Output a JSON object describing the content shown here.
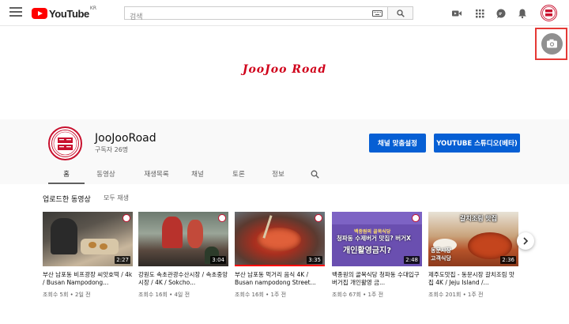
{
  "topbar": {
    "logo_text": "YouTube",
    "logo_region": "KR",
    "search_placeholder": "검색",
    "icons": [
      "menu-icon",
      "keyboard-icon",
      "search-icon",
      "video-camera-icon",
      "apps-grid-icon",
      "chat-icon",
      "bell-icon"
    ]
  },
  "banner": {
    "title": "JooJoo Road",
    "camera_icon": "camera-icon"
  },
  "channel": {
    "name": "JooJooRoad",
    "subscribers": "구독자 26명",
    "customize_label": "채널 맞춤설정",
    "studio_label": "YOUTUBE 스튜디오(베타)",
    "avatar_lettering": "쥬쥬로드"
  },
  "tabs": [
    {
      "label": "홈",
      "active": true
    },
    {
      "label": "동영상",
      "active": false
    },
    {
      "label": "재생목록",
      "active": false
    },
    {
      "label": "채널",
      "active": false
    },
    {
      "label": "토론",
      "active": false
    },
    {
      "label": "정보",
      "active": false
    }
  ],
  "section": {
    "title": "업로드한 동영상",
    "play_all": "모두 재생"
  },
  "videos": [
    {
      "title": "부산 남포동 비프광장 씨앗호떡 / 4k / Busan Nampodong...",
      "meta": "조회수 5회 • 2일 전",
      "duration": "2:27",
      "watched": 0
    },
    {
      "title": "강원도 속초관광수산시장 / 속초중앙시장 / 4K / Sokcho...",
      "meta": "조회수 16회 • 4일 전",
      "duration": "3:04",
      "watched": 0
    },
    {
      "title": "부산 남포동 먹거리 음식 4K / Busan nampodong Street...",
      "meta": "조회수 16회 • 1주 전",
      "duration": "3:35",
      "watched": 1.0
    },
    {
      "title": "백종원의 골목식당 청파동 수대입구 버거집 개인활영 금...",
      "meta": "조회수 67회 • 1주 전",
      "duration": "2:48",
      "watched": 0,
      "thumb_text": [
        "백종원의 골목식당",
        "청파동 수제버거 맛집? 버거X",
        "개인활영금지?"
      ]
    },
    {
      "title": "제주도맛집 - 동문시장 갈치조림 맛집 4K / Jeju Island /...",
      "meta": "조회수 201회 • 1주 전",
      "duration": "2:36",
      "watched": 0,
      "thumb_text": [
        "갈치조림 맛집",
        "동문시장",
        "고객식당"
      ]
    }
  ],
  "colors": {
    "accent_blue": "#065fd4",
    "youtube_red": "#ff0000",
    "brand_red": "#d0021b",
    "highlight_frame": "#e53935"
  }
}
